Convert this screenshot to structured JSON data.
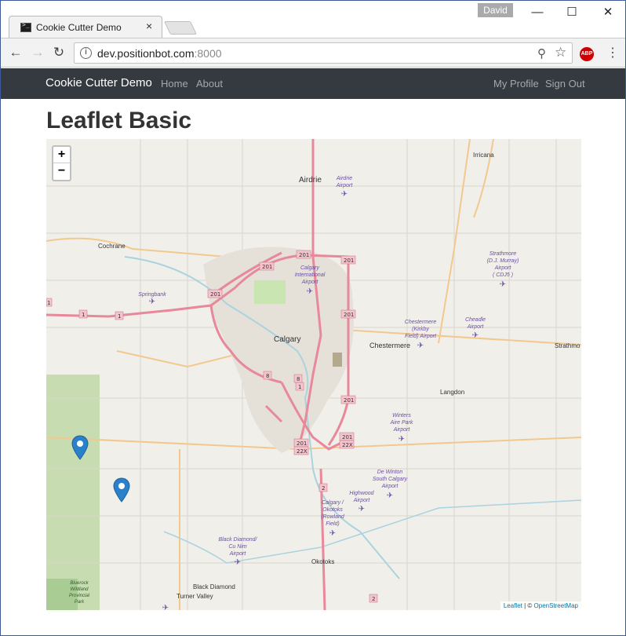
{
  "browser": {
    "tab_title": "Cookie Cutter Demo",
    "tab_close": "×",
    "user": "David",
    "url_host": "dev.positionbot.com",
    "url_port": ":8000",
    "info": "i",
    "back": "←",
    "forward": "→",
    "reload": "↻",
    "zoom": "⚲",
    "star": "☆",
    "abp": "ABP",
    "menu": "⋮",
    "minimize": "—",
    "maximize": "☐",
    "close": "✕"
  },
  "navbar": {
    "brand": "Cookie Cutter Demo",
    "links": [
      "Home",
      "About"
    ],
    "right_links": [
      "My Profile",
      "Sign Out"
    ]
  },
  "page": {
    "title": "Leaflet Basic"
  },
  "map": {
    "zoom_in": "+",
    "zoom_out": "−",
    "attribution_leaflet": "Leaflet",
    "attribution_sep": " | © ",
    "attribution_osm": "OpenStreetMap",
    "places": [
      {
        "label": "Airdrie",
        "type": "town"
      },
      {
        "label": "Irricana",
        "type": "small"
      },
      {
        "label": "Cochrane",
        "type": "small"
      },
      {
        "label": "Calgary",
        "type": "city"
      },
      {
        "label": "Chestermere",
        "type": "town"
      },
      {
        "label": "Strathmo",
        "type": "small"
      },
      {
        "label": "Langdon",
        "type": "small"
      },
      {
        "label": "Okotoks",
        "type": "small"
      },
      {
        "label": "Black Diamond",
        "type": "small"
      },
      {
        "label": "Turner Valley",
        "type": "small"
      }
    ],
    "airports": [
      {
        "lines": [
          "Airdrie",
          "Airport"
        ]
      },
      {
        "lines": [
          "Strathmore",
          "(D.J. Murray)",
          "Airport",
          "( CDJ5 )"
        ]
      },
      {
        "lines": [
          "Springbank"
        ]
      },
      {
        "lines": [
          "Calgary",
          "International",
          "Airport"
        ]
      },
      {
        "lines": [
          "Chestermere",
          "(Kirkby",
          "Field) Airport"
        ]
      },
      {
        "lines": [
          "Cheadle",
          "Airport"
        ]
      },
      {
        "lines": [
          "Winters",
          "Aire Park",
          "Airport"
        ]
      },
      {
        "lines": [
          "De Winton",
          "South Calgary",
          "Airport"
        ]
      },
      {
        "lines": [
          "Highwood",
          "Airport"
        ]
      },
      {
        "lines": [
          "Calgary /",
          "Okotoks",
          "(Rowland",
          "Field)"
        ]
      },
      {
        "lines": [
          "Black Diamond/",
          "Cu Nim",
          "Airport"
        ]
      }
    ],
    "park_labels": [
      "Bluerock",
      "Wildland",
      "Provincial",
      "Park"
    ],
    "shields": [
      "201",
      "201",
      "201",
      "201",
      "201",
      "201",
      "201",
      "201",
      "22X",
      "22X",
      "1",
      "1",
      "1",
      "1",
      "8",
      "8",
      "2",
      "2"
    ],
    "markers": [
      {
        "name": "marker-1"
      },
      {
        "name": "marker-2"
      }
    ],
    "colors": {
      "land": "#f1efea",
      "motorway": "#e7889b",
      "trunk": "#f6b56a",
      "park": "#a8d49c",
      "water": "#aad3df",
      "marker": "#2a81cb"
    }
  }
}
